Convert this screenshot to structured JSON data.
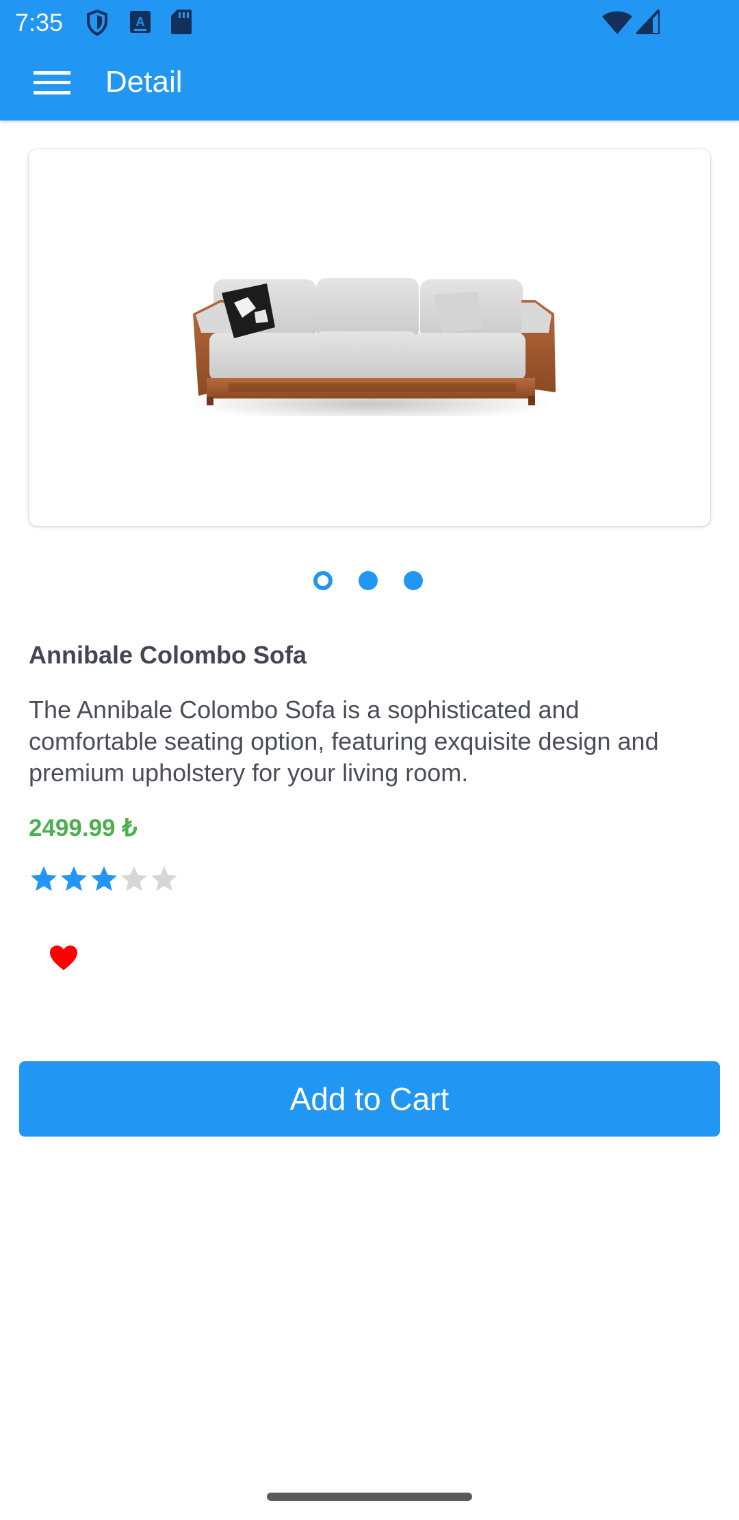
{
  "status_bar": {
    "time": "7:35",
    "icons": [
      "vpn-shield-icon",
      "accessibility-icon",
      "sd-card-icon",
      "wifi-icon",
      "cell-signal-icon"
    ]
  },
  "app_bar": {
    "menu_icon": "hamburger-menu-icon",
    "title": "Detail"
  },
  "product": {
    "image_icon": "sofa-image",
    "carousel": {
      "count": 3,
      "active_index": 0
    },
    "name": "Annibale Colombo Sofa",
    "description": "The Annibale Colombo Sofa is a sophisticated and comfortable seating option, featuring exquisite design and premium upholstery for your living room.",
    "price": "2499.99 ₺",
    "rating": {
      "value": 3,
      "max": 5
    },
    "favorite": true
  },
  "actions": {
    "add_to_cart_label": "Add to Cart"
  },
  "colors": {
    "primary": "#2196f3",
    "price": "#4caf50",
    "favorite": "#ff0000",
    "star_empty": "#d6d6d6"
  }
}
